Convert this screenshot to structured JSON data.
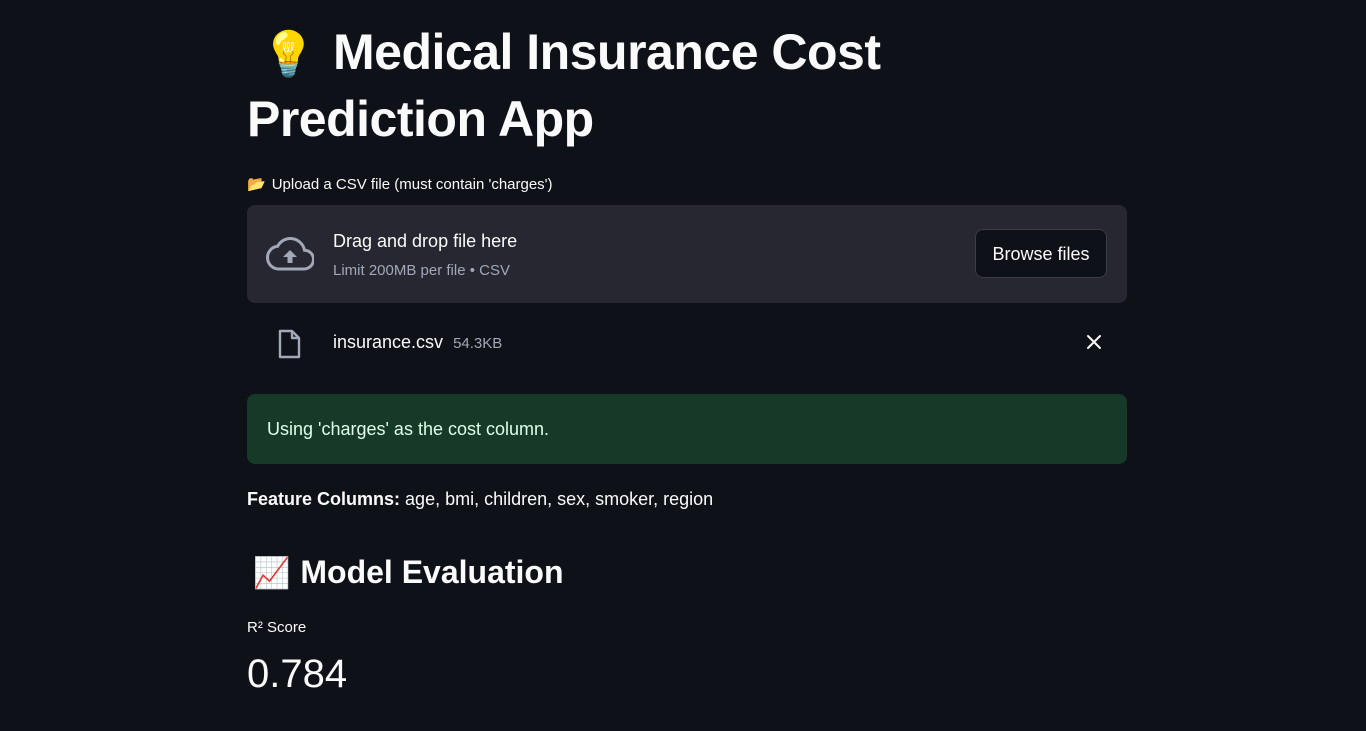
{
  "header": {
    "emoji": "💡",
    "title": "Medical Insurance Cost Prediction App"
  },
  "uploader": {
    "label_emoji": "📂",
    "label": "Upload a CSV file (must contain 'charges')",
    "drop_title": "Drag and drop file here",
    "drop_subtitle": "Limit 200MB per file • CSV",
    "browse_label": "Browse files",
    "uploaded_file": {
      "name": "insurance.csv",
      "size": "54.3KB"
    }
  },
  "alert": {
    "message": "Using 'charges' as the cost column."
  },
  "features": {
    "label": "Feature Columns:",
    "value": "age, bmi, children, sex, smoker, region"
  },
  "evaluation": {
    "emoji": "📈",
    "title": "Model Evaluation",
    "metric_label": "R² Score",
    "metric_value": "0.784"
  },
  "colors": {
    "background": "#0e1117",
    "dropzone": "#262730",
    "success_bg": "#173928",
    "success_text": "#dffde9"
  }
}
